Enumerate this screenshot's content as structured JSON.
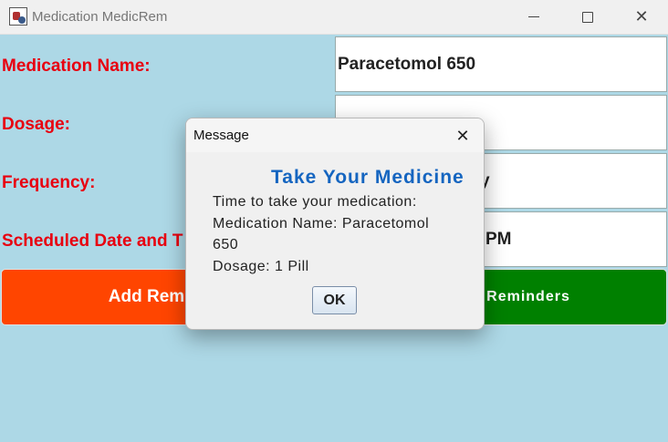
{
  "window": {
    "title": "Medication MedicRem",
    "icon": "app-icon",
    "controls": {
      "minimize": "minimize-icon",
      "maximize": "maximize-icon",
      "close": "close-icon"
    }
  },
  "form": {
    "medication_name_label": "Medication Name:",
    "medication_name_value": "Paracetomol 650",
    "dosage_label": "Dosage:",
    "dosage_value": "",
    "frequency_label": "Frequency:",
    "frequency_value": "y",
    "schedule_label": "Scheduled Date and T",
    "schedule_value": "PM"
  },
  "buttons": {
    "add_label": "Add Rem",
    "view_label": "Reminders"
  },
  "dialog": {
    "title": "Message",
    "heading": "Take Your Medicine",
    "lines": [
      "Time to take your medication:",
      "Medication Name: Paracetomol",
      "650",
      "Dosage: 1 Pill"
    ],
    "ok_label": "OK"
  },
  "colors": {
    "background": "#add8e6",
    "label_red": "#e8000f",
    "add_button": "#ff4500",
    "view_button": "#008000",
    "heading_blue": "#1565c0"
  }
}
